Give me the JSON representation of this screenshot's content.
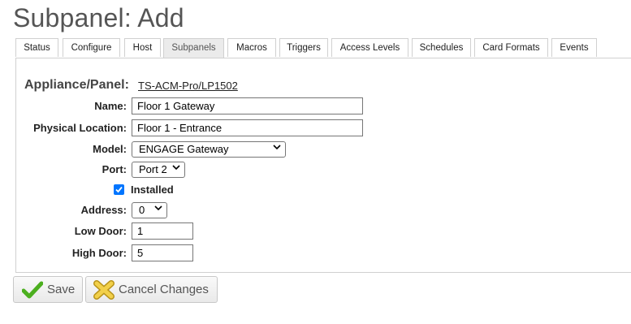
{
  "page": {
    "title": "Subpanel: Add"
  },
  "tabs": [
    {
      "label": "Status"
    },
    {
      "label": "Configure"
    },
    {
      "label": "Host"
    },
    {
      "label": "Subpanels",
      "active": true
    },
    {
      "label": "Macros"
    },
    {
      "label": "Triggers"
    },
    {
      "label": "Access Levels"
    },
    {
      "label": "Schedules"
    },
    {
      "label": "Card Formats"
    },
    {
      "label": "Events"
    }
  ],
  "form": {
    "appliance_label": "Appliance/Panel:",
    "appliance_link": "TS-ACM-Pro/LP1502",
    "name": {
      "label": "Name:",
      "value": "Floor 1 Gateway"
    },
    "physical_location": {
      "label": "Physical Location:",
      "value": "Floor 1 - Entrance"
    },
    "model": {
      "label": "Model:",
      "value": "ENGAGE Gateway"
    },
    "port": {
      "label": "Port:",
      "value": "Port 2"
    },
    "installed": {
      "label": "Installed",
      "checked": true
    },
    "address": {
      "label": "Address:",
      "value": "0"
    },
    "low_door": {
      "label": "Low Door:",
      "value": "1"
    },
    "high_door": {
      "label": "High Door:",
      "value": "5"
    }
  },
  "actions": {
    "save_label": "Save",
    "cancel_label": "Cancel Changes"
  },
  "colors": {
    "accent_check": "#0075ff",
    "save_icon": "#4caf1f",
    "cancel_icon": "#e8c23a"
  }
}
